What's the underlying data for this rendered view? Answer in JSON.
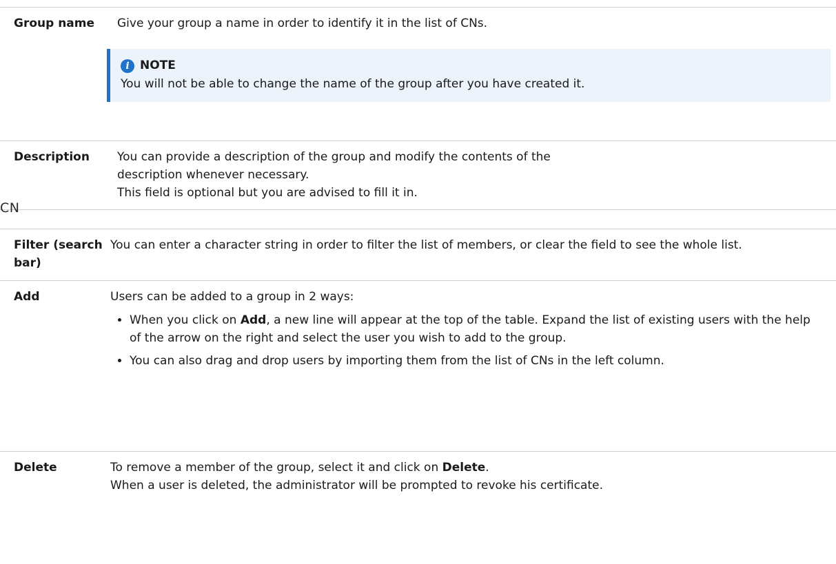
{
  "group_table": {
    "rows": [
      {
        "label": "Group name",
        "text": "Give your group a name in order to identify it in the list of CNs.",
        "note": {
          "icon": "info-circle-icon",
          "title": "NOTE",
          "text": "You will not be able to change the name of the group after you have created it."
        }
      },
      {
        "label": "Description",
        "lines": [
          "You can provide a description of the group and modify the contents of the",
          "description whenever necessary.",
          "This field is optional but you are advised to fill it in."
        ]
      }
    ]
  },
  "cn_section": {
    "heading": "CN",
    "filter": {
      "label": "Filter (search bar)",
      "text": "You can enter a character string in order to filter the list of members, or clear the field to see the whole list."
    },
    "add": {
      "label": "Add",
      "intro": "Users can be added to a group in 2 ways:",
      "bullet1": {
        "prefix": "When you click on ",
        "bold": "Add",
        "rest": ", a new line will appear at the top of the table. Expand the list of existing users with the help of the arrow on the right and select the user you wish to add to the group."
      },
      "bullet2": "You can also drag and drop users by importing them from the list of CNs in the left column."
    },
    "delete": {
      "label": "Delete",
      "prefix": "To remove a member of the group, select it and click on ",
      "bold": "Delete",
      "suffix": ".",
      "line2": "When a user is deleted, the administrator will be prompted to revoke his certificate."
    }
  },
  "colors": {
    "accent": "#1f73c8",
    "note_bg": "#ecf3fb",
    "rule": "#cfcfcf"
  }
}
